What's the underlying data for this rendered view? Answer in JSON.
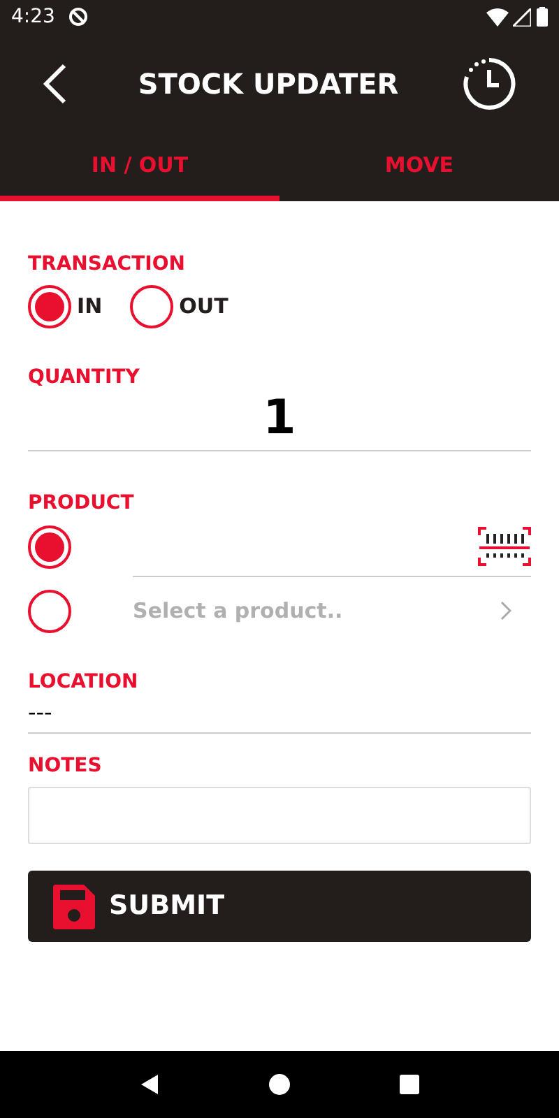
{
  "status_bar": {
    "time": "4:23"
  },
  "header": {
    "title": "STOCK UPDATER"
  },
  "tabs": [
    {
      "label": "IN / OUT",
      "selected": true
    },
    {
      "label": "MOVE",
      "selected": false
    }
  ],
  "transaction": {
    "label": "TRANSACTION",
    "options": [
      {
        "label": "IN",
        "selected": true
      },
      {
        "label": "OUT",
        "selected": false
      }
    ]
  },
  "quantity": {
    "label": "QUANTITY",
    "value": "1"
  },
  "product": {
    "label": "PRODUCT",
    "options": [
      {
        "kind": "scan",
        "selected": true
      },
      {
        "kind": "select",
        "selected": false,
        "placeholder": "Select a product.."
      }
    ]
  },
  "location": {
    "label": "LOCATION",
    "value": "---"
  },
  "notes": {
    "label": "NOTES"
  },
  "submit": {
    "label": "SUBMIT"
  }
}
